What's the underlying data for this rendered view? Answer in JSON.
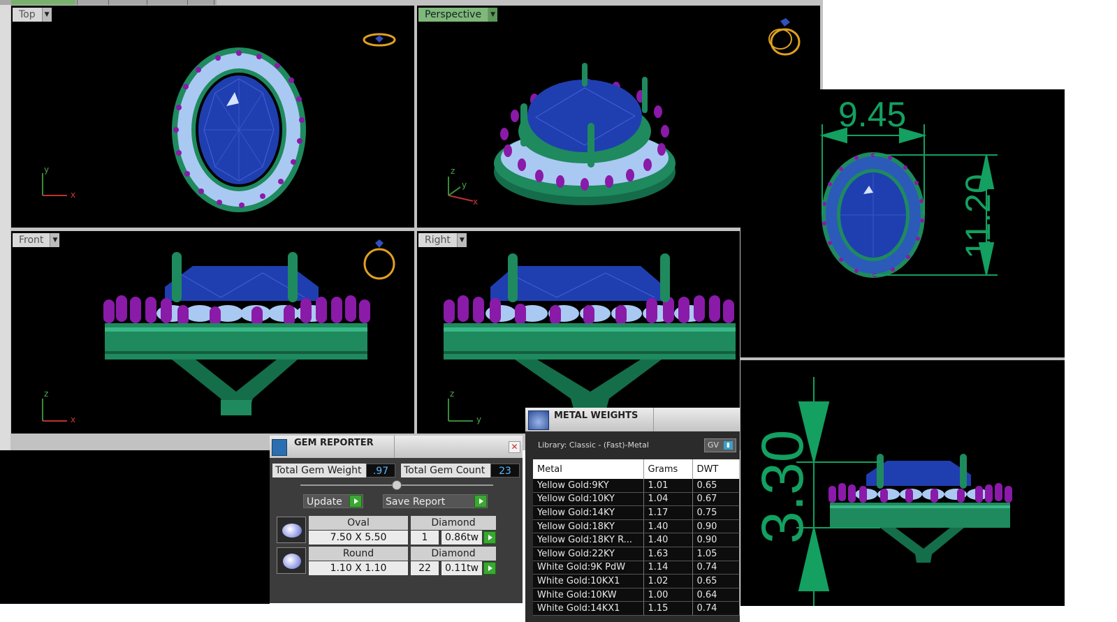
{
  "viewports": {
    "top": {
      "label": "Top"
    },
    "perspective": {
      "label": "Perspective"
    },
    "front": {
      "label": "Front"
    },
    "right": {
      "label": "Right"
    }
  },
  "axes": {
    "x": "x",
    "y": "y",
    "z": "z"
  },
  "dimensions": {
    "width": "9.45",
    "length": "11.20",
    "height": "3.30"
  },
  "gem_reporter": {
    "title": "GEM REPORTER",
    "total_weight_label": "Total Gem Weight",
    "total_weight_value": ".97",
    "total_count_label": "Total Gem Count",
    "total_count_value": "23",
    "update_label": "Update",
    "save_report_label": "Save Report",
    "gems": [
      {
        "shape": "Oval",
        "material": "Diamond",
        "size": "7.50 X 5.50",
        "count": "1",
        "weight": "0.86tw"
      },
      {
        "shape": "Round",
        "material": "Diamond",
        "size": "1.10 X 1.10",
        "count": "22",
        "weight": "0.11tw"
      }
    ]
  },
  "metal_weights": {
    "title": "METAL WEIGHTS",
    "library": "Library: Classic - (Fast)-Metal",
    "library_button": "GV",
    "columns": [
      "Metal",
      "Grams",
      "DWT"
    ],
    "rows": [
      [
        "Yellow Gold:9KY",
        "1.01",
        "0.65"
      ],
      [
        "Yellow Gold:10KY",
        "1.04",
        "0.67"
      ],
      [
        "Yellow Gold:14KY",
        "1.17",
        "0.75"
      ],
      [
        "Yellow Gold:18KY",
        "1.40",
        "0.90"
      ],
      [
        "Yellow Gold:18KY R...",
        "1.40",
        "0.90"
      ],
      [
        "Yellow Gold:22KY",
        "1.63",
        "1.05"
      ],
      [
        "White Gold:9K PdW",
        "1.14",
        "0.74"
      ],
      [
        "White Gold:10KX1",
        "1.02",
        "0.65"
      ],
      [
        "White Gold:10KW",
        "1.00",
        "0.64"
      ],
      [
        "White Gold:14KX1",
        "1.15",
        "0.74"
      ]
    ]
  },
  "colors": {
    "metal": "#1e8a5e",
    "center_stone": "#1f3fb0",
    "accent_stones": "#a8c8f0",
    "prongs": "#8a1aa8",
    "dimension_lines": "#13a060",
    "active_viewport_label": "#7fb87a"
  }
}
